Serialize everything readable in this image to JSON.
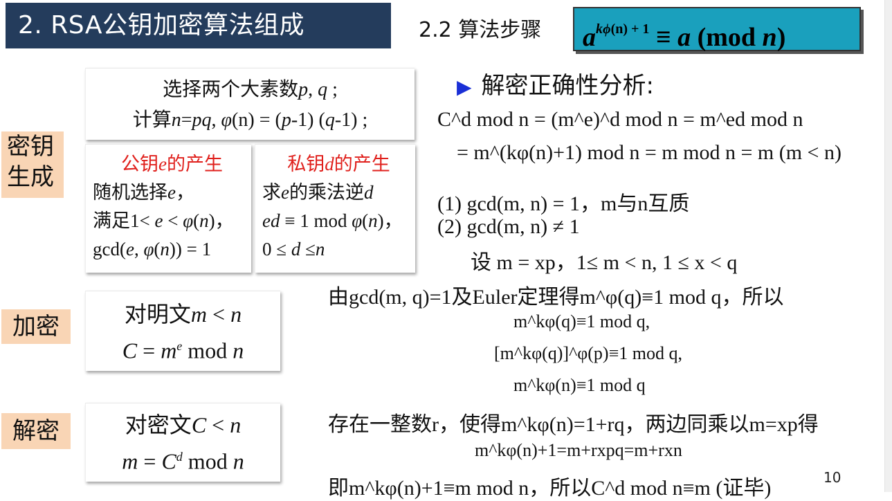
{
  "header": {
    "title": "2. RSA公钥加密算法组成",
    "subtitle": "2.2 算法步骤",
    "formula_base": "a",
    "formula_exp_k": "k",
    "formula_exp_phi": "ϕ",
    "formula_exp_n": "(n)",
    "formula_exp_plus": " + 1",
    "formula_equiv": " ≡  ",
    "formula_rhs_a": "a",
    "formula_rhs_mod": " (mod ",
    "formula_rhs_n": "n",
    "formula_rhs_close": ")"
  },
  "labels": {
    "keygen_line1": "密钥",
    "keygen_line2": "生成",
    "encrypt": "加密",
    "decrypt": "解密"
  },
  "keygen_top": {
    "line1_cn": "选择两个大素数",
    "line1_p": "p",
    "line1_comma": ", ",
    "line1_q": "q",
    "line1_end": " ;",
    "line2_cn": "计算",
    "line2_n": "n",
    "line2_eq": "=",
    "line2_pq": "pq",
    "line2_comma": ", ",
    "line2_phi": "φ",
    "line2_paren_n": "(n)",
    "line2_rest1": " = (",
    "line2_p": "p",
    "line2_rest2": "-1) (",
    "line2_q": "q",
    "line2_rest3": "-1) ;"
  },
  "public_key": {
    "title_pre": "公钥",
    "title_e": "e",
    "title_post": "的产生",
    "l1_cn": "随机选择",
    "l1_e": "e",
    "l1_end": "，",
    "l2_cn": "满足",
    "l2_math_a": "1< ",
    "l2_e": "e",
    "l2_math_b": " < ",
    "l2_phi": "φ",
    "l2_math_c": "(",
    "l2_n": "n",
    "l2_math_d": ")",
    "l2_end": "，",
    "l3_a": "gcd(",
    "l3_e": "e",
    "l3_b": ", ",
    "l3_phi": "φ",
    "l3_c": "(",
    "l3_n": "n",
    "l3_d": ")) = 1"
  },
  "private_key": {
    "title_pre": "私钥",
    "title_d": "d",
    "title_post": "的产生",
    "l1_cn": "求",
    "l1_e": "e",
    "l1_cn2": "的乘法逆",
    "l1_d": "d",
    "l2_ed": "ed",
    "l2_a": " ≡ 1 mod ",
    "l2_phi": "φ",
    "l2_b": "(",
    "l2_n": "n",
    "l2_c": ")",
    "l2_end": "，",
    "l3_a": "0 ≤ ",
    "l3_d": "d",
    "l3_b": " ≤",
    "l3_n": "n"
  },
  "encrypt_card": {
    "l1_cn": "对明文",
    "l1_m": "m",
    "l1_lt": " < ",
    "l1_n": "n",
    "l2_C": "C",
    "l2_eq": " = ",
    "l2_m": "m",
    "l2_e": "e",
    "l2_mod": " mod ",
    "l2_n": "n"
  },
  "decrypt_card": {
    "l1_cn": "对密文",
    "l1_C": "C",
    "l1_lt": " < ",
    "l1_n": "n",
    "l2_m": "m",
    "l2_eq": " = ",
    "l2_C": "C",
    "l2_d": "d",
    "l2_mod": " mod ",
    "l2_n": "n"
  },
  "proof": {
    "heading": "解密正确性分析:",
    "arrow_icon": "triangle-right",
    "r1": "C^d mod n = (m^e)^d mod n = m^ed mod n",
    "r2": "= m^(kφ(n)+1) mod n = m mod n = m (m < n)",
    "c1": "(1) gcd(m, n) = 1，m与n互质",
    "c2": "(2) gcd(m, n) ≠ 1",
    "set": "设  m = xp，1≤ m < n, 1 ≤ x < q",
    "euler": "由gcd(m, q)=1及Euler定理得m^φ(q)≡1 mod q，所以",
    "e1": "m^kφ(q)≡1 mod q,",
    "e2": "[m^kφ(q)]^φ(p)≡1 mod q,",
    "e3": "m^kφ(n)≡1 mod q",
    "exist": "存在一整数r，使得m^kφ(n)=1+rq，两边同乘以m=xp得",
    "e4": "m^kφ(n)+1=m+rxpq=m+rxn",
    "final": "即m^kφ(n)+1≡m mod n，所以C^d mod n≡m (证毕)"
  },
  "page_number": "10",
  "colors": {
    "title_bg": "#243c5c",
    "formula_bg": "#1aa0bd",
    "label_bg": "#f9d5b5",
    "accent_red": "#e0201c",
    "accent_blue": "#1a2fd6"
  }
}
